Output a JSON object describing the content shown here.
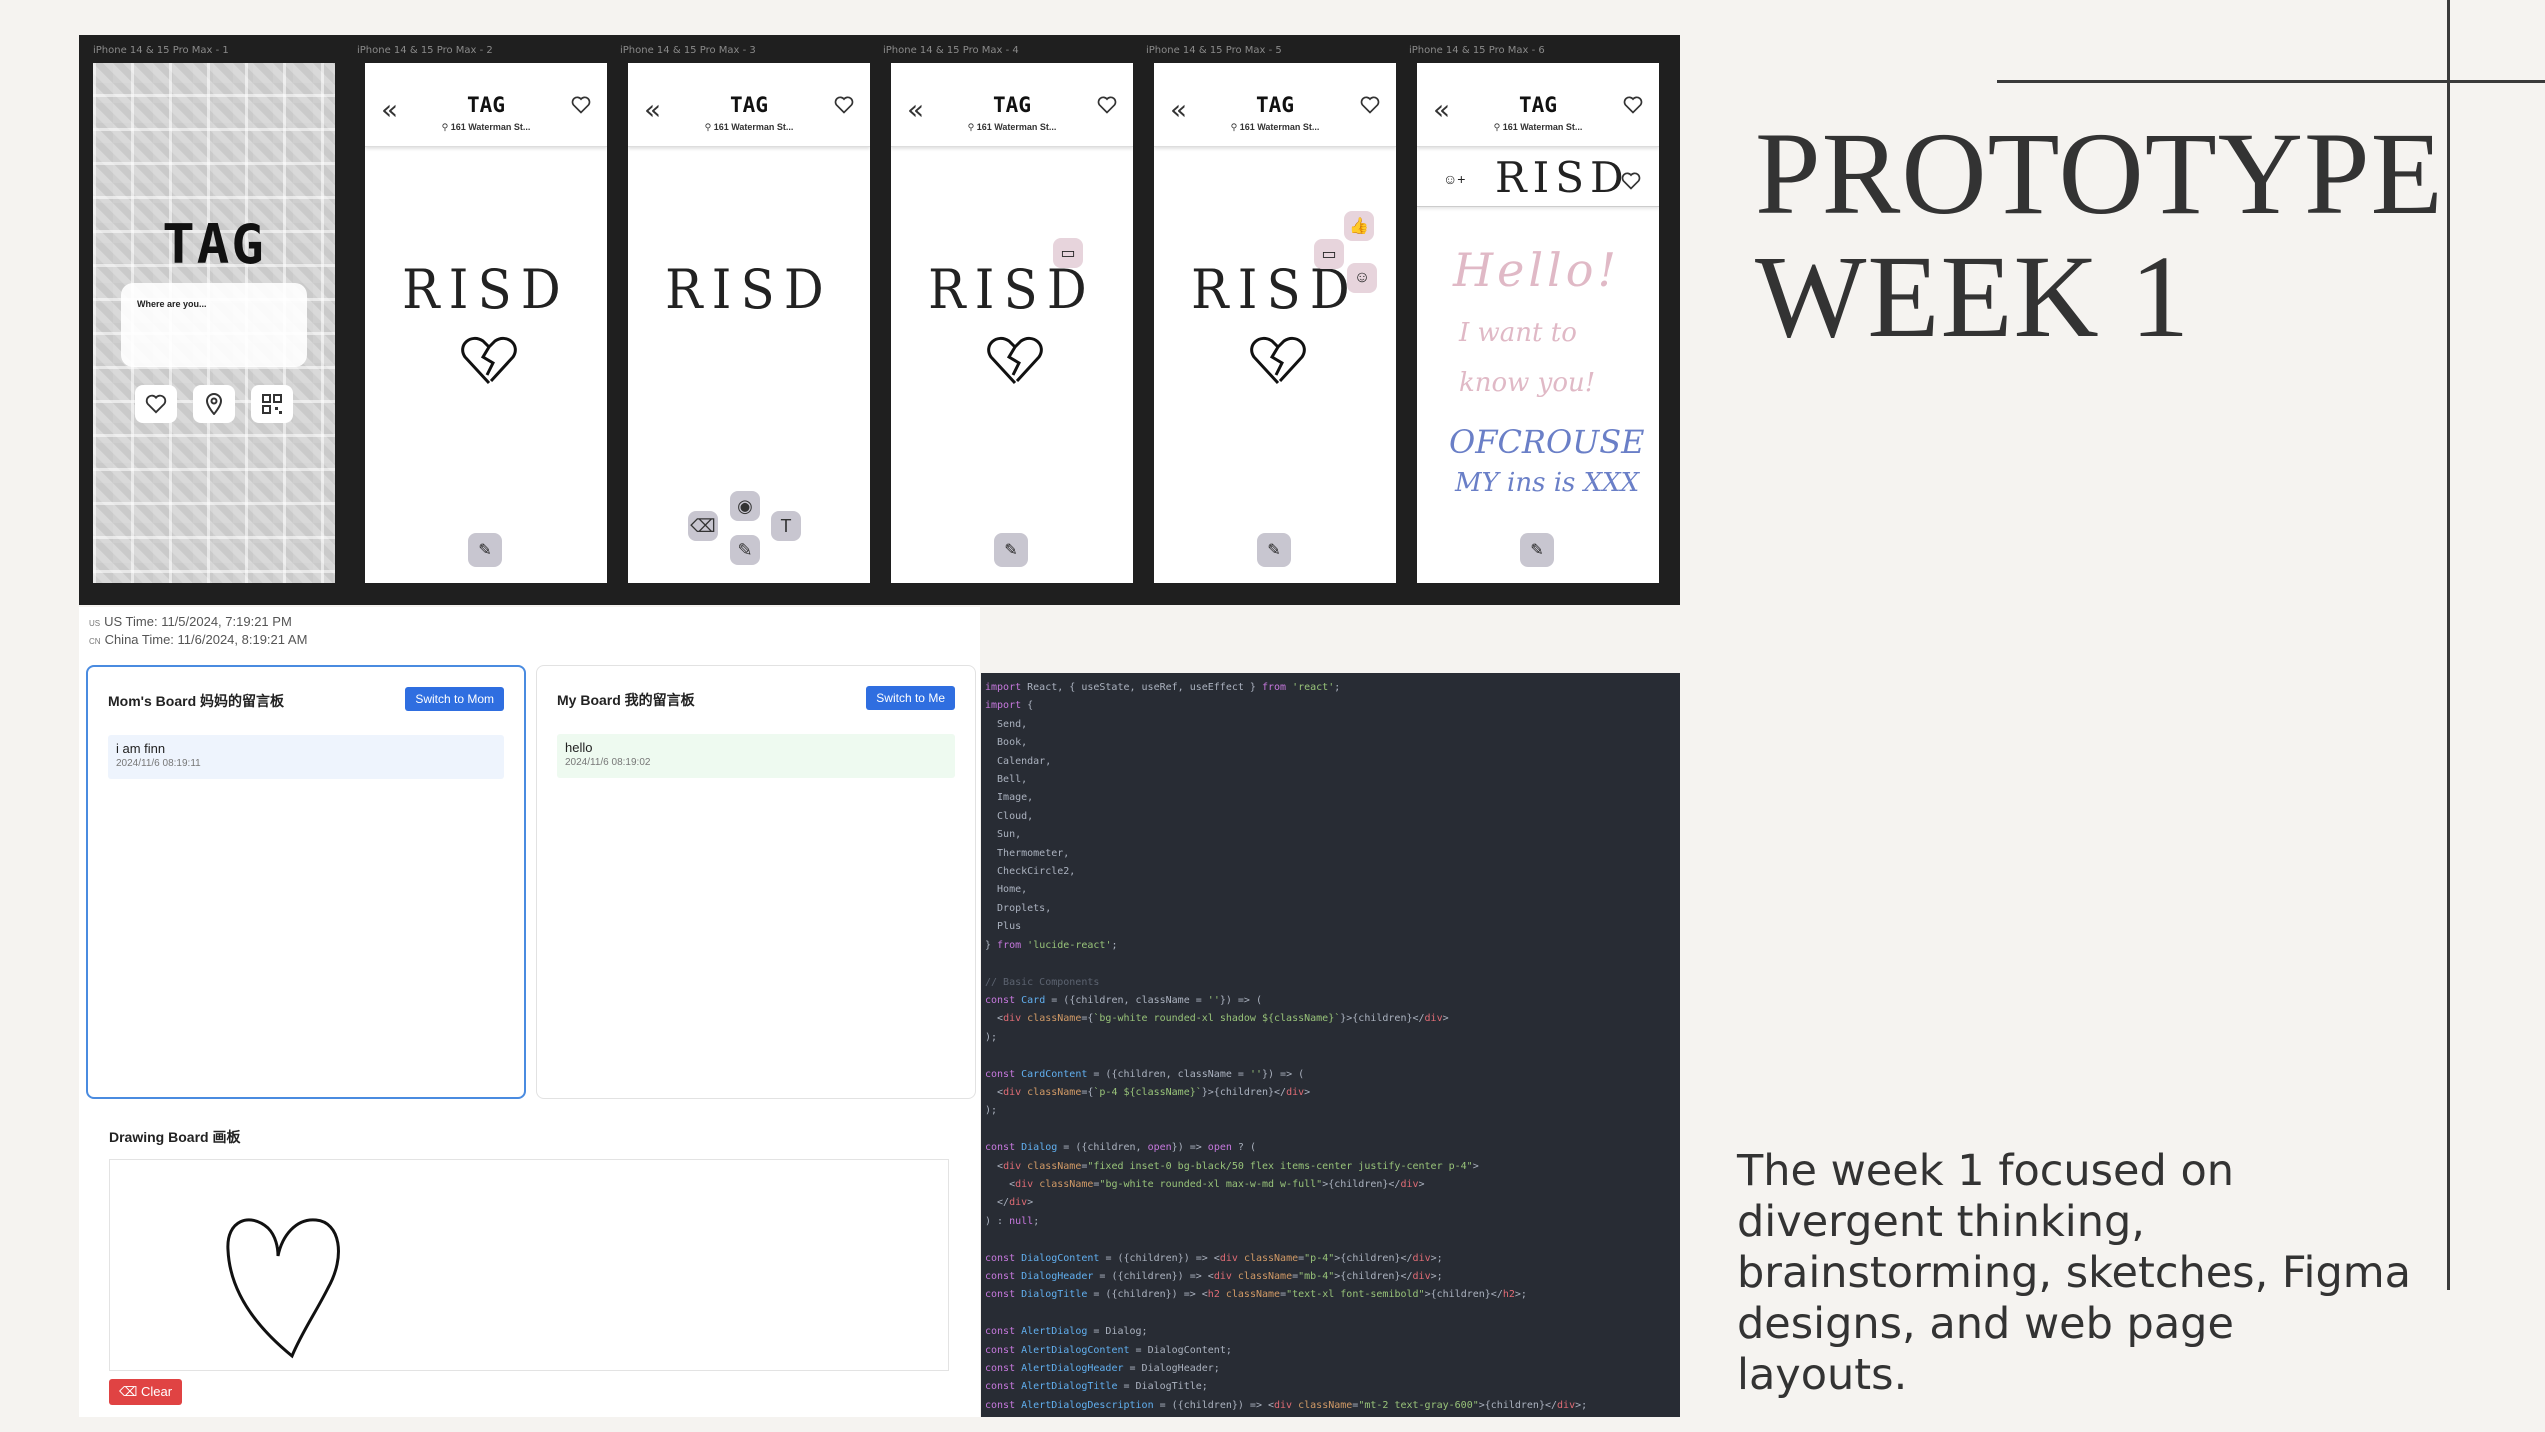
{
  "slide": {
    "title_line1": "PROTOTYPE",
    "title_line2": "WEEK 1",
    "description": "The week 1 focused on divergent thinking, brainstorming, sketches, Figma designs, and web page layouts."
  },
  "figma": {
    "frames": [
      {
        "label": "iPhone 14 & 15 Pro Max - 1"
      },
      {
        "label": "iPhone 14 & 15 Pro Max - 2"
      },
      {
        "label": "iPhone 14 & 15 Pro Max - 3"
      },
      {
        "label": "iPhone 14 & 15 Pro Max - 4"
      },
      {
        "label": "iPhone 14 & 15 Pro Max - 5"
      },
      {
        "label": "iPhone 14 & 15 Pro Max - 6"
      }
    ],
    "app_title": "TAG",
    "address": "161 Waterman St...",
    "where_prompt": "Where are you...",
    "drawing_word": "RISD",
    "handwriting": {
      "line1": "Hello!",
      "line2": "I want to",
      "line3": "know you!",
      "line4": "OFCROUSE",
      "line5": "MY ins is XXX"
    }
  },
  "web": {
    "us_flag": "US",
    "us_time": "US Time: 11/5/2024, 7:19:21 PM",
    "cn_flag": "CN",
    "china_time": "China Time: 11/6/2024, 8:19:21 AM",
    "moms_board": {
      "title": "Mom's Board 妈妈的留言板",
      "button": "Switch to Mom",
      "message": "i am finn",
      "timestamp": "2024/11/6 08:19:11"
    },
    "my_board": {
      "title": "My Board 我的留言板",
      "button": "Switch to Me",
      "message": "hello",
      "timestamp": "2024/11/6 08:19:02"
    },
    "drawing_board": {
      "title": "Drawing Board 画板",
      "clear_button": "Clear"
    }
  },
  "code": {
    "lines": [
      "import React, { useState, useRef, useEffect } from 'react';",
      "import {",
      "  Send,",
      "  Book,",
      "  Calendar,",
      "  Bell,",
      "  Image,",
      "  Cloud,",
      "  Sun,",
      "  Thermometer,",
      "  CheckCircle2,",
      "  Home,",
      "  Droplets,",
      "  Plus",
      "} from 'lucide-react';",
      "",
      "// Basic Components",
      "const Card = ({children, className = ''}) => (",
      "  <div className={`bg-white rounded-xl shadow ${className}`}>{children}</div>",
      ");",
      "",
      "const CardContent = ({children, className = ''}) => (",
      "  <div className={`p-4 ${className}`}>{children}</div>",
      ");",
      "",
      "const Dialog = ({children, open}) => open ? (",
      "  <div className=\"fixed inset-0 bg-black/50 flex items-center justify-center p-4\">",
      "    <div className=\"bg-white rounded-xl max-w-md w-full\">{children}</div>",
      "  </div>",
      ") : null;",
      "",
      "const DialogContent = ({children}) => <div className=\"p-4\">{children}</div>;",
      "const DialogHeader = ({children}) => <div className=\"mb-4\">{children}</div>;",
      "const DialogTitle = ({children}) => <h2 className=\"text-xl font-semibold\">{children}</h2>;",
      "",
      "const AlertDialog = Dialog;",
      "const AlertDialogContent = DialogContent;",
      "const AlertDialogHeader = DialogHeader;",
      "const AlertDialogTitle = DialogTitle;",
      "const AlertDialogDescription = ({children}) => <div className=\"mt-2 text-gray-600\">{children}</div>;"
    ]
  }
}
